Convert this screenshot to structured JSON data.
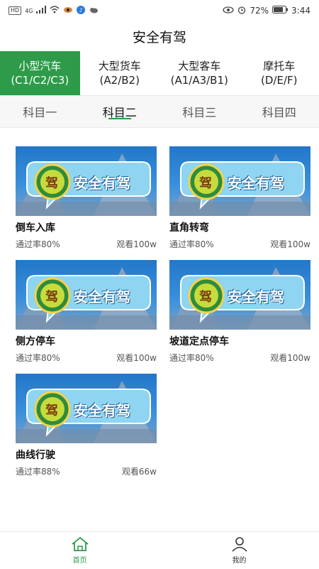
{
  "status": {
    "battery": "72%",
    "time": "3:44",
    "hd": "HD",
    "net": "4G"
  },
  "title": "安全有驾",
  "categories": [
    {
      "name": "小型汽车",
      "code": "(C1/C2/C3)",
      "active": true
    },
    {
      "name": "大型货车",
      "code": "(A2/B2)"
    },
    {
      "name": "大型客车",
      "code": "(A1/A3/B1)"
    },
    {
      "name": "摩托车",
      "code": "(D/E/F)"
    }
  ],
  "subjects": [
    "科目一",
    "科目二",
    "科目三",
    "科目四"
  ],
  "thumbnail": {
    "logo_text": "安全有驾",
    "badge_char": "驾"
  },
  "lessons": [
    {
      "title": "倒车入库",
      "pass_rate": "通过率80%",
      "views": "观看100w"
    },
    {
      "title": "直角转弯",
      "pass_rate": "通过率80%",
      "views": "观看100w"
    },
    {
      "title": "侧方停车",
      "pass_rate": "通过率80%",
      "views": "观看100w"
    },
    {
      "title": "坡道定点停车",
      "pass_rate": "通过率80%",
      "views": "观看100w"
    },
    {
      "title": "曲线行驶",
      "pass_rate": "通过率88%",
      "views": "观看66w"
    }
  ],
  "tabbar": {
    "home": "首页",
    "mine": "我的"
  },
  "colors": {
    "accent": "#2d9b49"
  }
}
